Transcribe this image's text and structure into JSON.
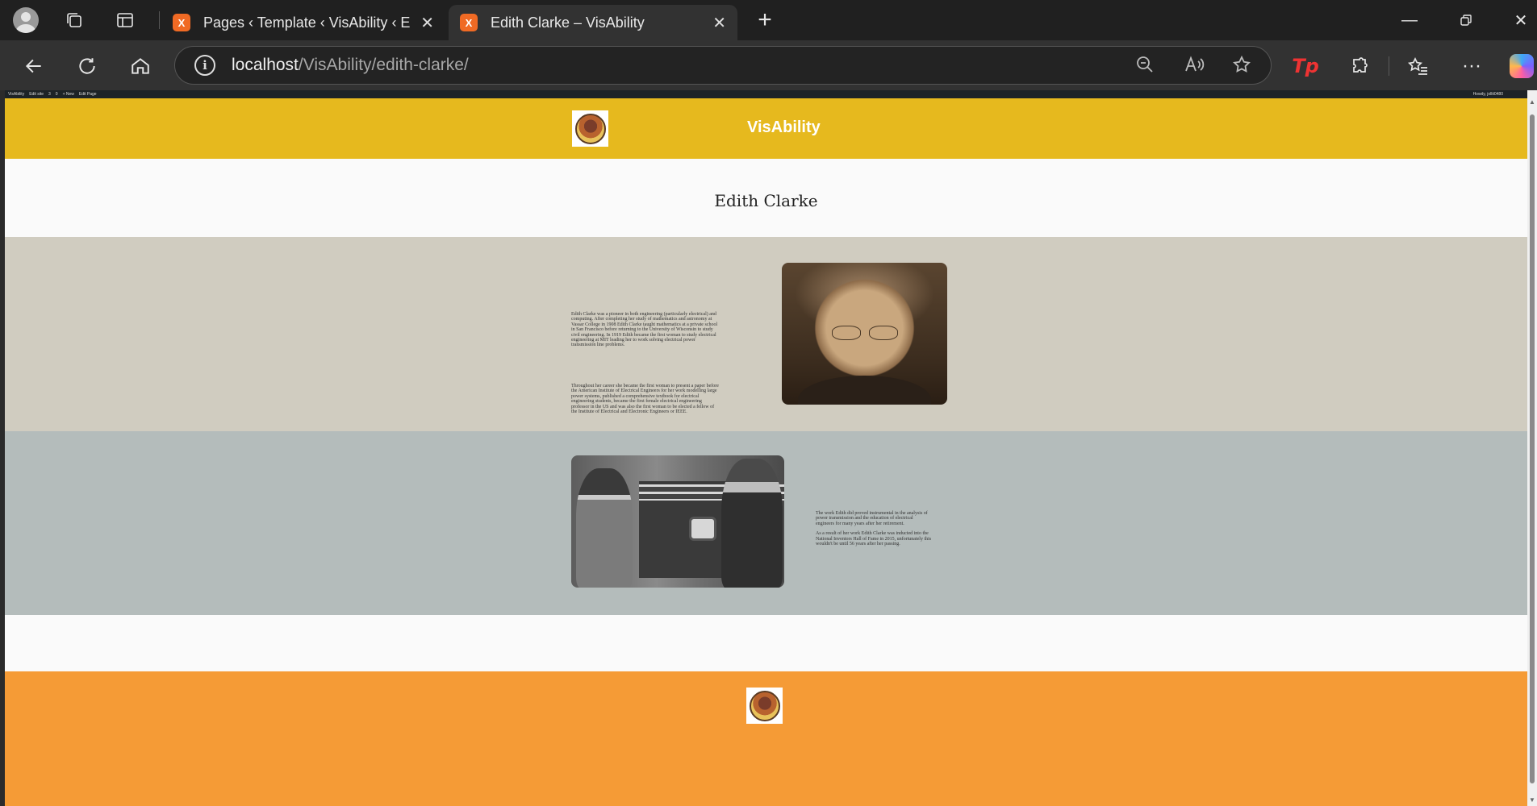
{
  "browser": {
    "tabs": [
      {
        "title": "Pages ‹ Template ‹ VisAbility ‹ Edit"
      },
      {
        "title": "Edith Clarke – VisAbility"
      }
    ],
    "url_host": "localhost",
    "url_path": "/VisAbility/edith-clarke/",
    "favicon": "X"
  },
  "admin_bar": {
    "items": [
      "VisAbility",
      "Edit site",
      "3",
      "0",
      "+ New",
      "Edit Page"
    ],
    "howdy": "Howdy, jollit0480"
  },
  "site": {
    "title": "VisAbility"
  },
  "page": {
    "title": "Edith Clarke",
    "bio_paragraph_1": "Edith Clarke was a pioneer in both engineering (particularly electrical) and computing. After completing her study of mathematics and astronomy at Vassar College in 1908 Edith Clarke taught mathematics at a private school in San Francisco before returning to the University of Wisconsin to study civil engineering. In 1919 Edith became the first woman to study electrical engineering at MIT leading her to work solving electrical power transmission line problems.",
    "bio_paragraph_2": "Throughout her career she became the first woman to present a paper before the American Institute of Electrical Engineers for her work modelling large power systems, published a comprehensive textbook for electrical engineering students, became the first female electrical engineering professor in the US and was also the first woman to be elected a fellow of the Institute of Electrical and Electronic Engineers or IEEE.",
    "legacy_paragraph_1": "The work Edith did proved instrumental in the analysis of power transmission and the education of electrical engineers for many years after her retirement.",
    "legacy_paragraph_2": "As a result of her work Edith Clarke was inducted into the National Inventors Hall of Fame in 2015, unfortunately this wouldn't be until 56 years after her passing."
  },
  "colors": {
    "header": "#e6b91e",
    "section_tan": "#d0ccc0",
    "section_grey": "#b4bcbb",
    "footer": "#f59b36"
  }
}
